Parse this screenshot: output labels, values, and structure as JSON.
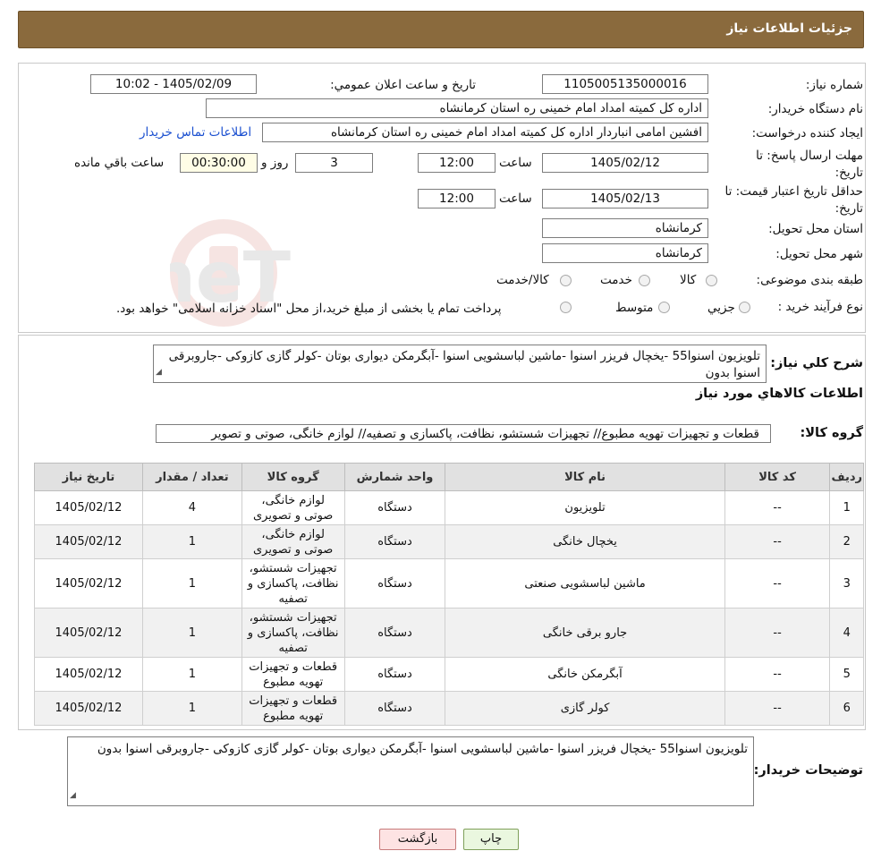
{
  "page_title": "جزئیات اطلاعات نیاز",
  "form": {
    "need_number_label": "شماره نیاز:",
    "need_number": "1105005135000016",
    "announce_label": "تاریخ و ساعت اعلان عمومي:",
    "announce_value": "1405/02/09 - 10:02",
    "buyer_org_label": "نام دستگاه خریدار:",
    "buyer_org": "اداره کل کمیته امداد امام خمینی  ره  استان کرمانشاه",
    "creator_label": "ایجاد کننده درخواست:",
    "creator": "افشین امامی انباردار اداره کل کمیته امداد امام خمینی  ره  استان کرمانشاه",
    "contact_link": "اطلاعات تماس خریدار",
    "reply_deadline_label": "مهلت ارسال پاسخ: تا تاریخ:",
    "reply_date": "1405/02/12",
    "time_label": "ساعت",
    "reply_time": "12:00",
    "days": "3",
    "days_label": "روز و",
    "remaining": "00:30:00",
    "remaining_label": "ساعت باقي مانده",
    "price_validity_label": "حداقل تاریخ اعتبار قیمت: تا تاریخ:",
    "price_date": "1405/02/13",
    "price_time": "12:00",
    "province_label": "استان محل تحویل:",
    "province": "کرمانشاه",
    "city_label": "شهر محل تحویل:",
    "city": "کرمانشاه",
    "category_label": "طبقه بندی موضوعی:",
    "category_options": [
      "کالا",
      "خدمت",
      "کالا/خدمت"
    ],
    "process_label": "نوع فرآیند خرید :",
    "process_options": [
      "جزیي",
      "متوسط"
    ],
    "process_note": "پرداخت تمام یا بخشی از مبلغ خرید،از محل \"اسناد خزانه اسلامی\" خواهد بود."
  },
  "watermark": "AriaTender.neT",
  "summary": {
    "label": "شرح کلي نیاز:",
    "text": "تلویزیون اسنوا55 -یخچال فریزر اسنوا -ماشین لباسشویی اسنوا -آبگرمکن دیواری بوتان -کولر گازی کازوکی -جاروبرقی اسنوا  بدون"
  },
  "goods_info_title": "اطلاعات کالاهاي مورد نیاز",
  "goods_group": {
    "label": "گروه کالا:",
    "value": "قطعات و تجهیزات تهویه مطبوع// تجهیزات شستشو، نظافت، پاکسازی و تصفیه// لوازم خانگی، صوتی و تصویر"
  },
  "table": {
    "headers": [
      "ردیف",
      "کد کالا",
      "نام کالا",
      "واحد شمارش",
      "گروه کالا",
      "تعداد / مقدار",
      "تاریخ نیاز"
    ],
    "rows": [
      {
        "idx": "1",
        "code": "--",
        "name": "تلویزیون",
        "unit": "دستگاه",
        "group": "لوازم خانگی، صوتی و تصویری",
        "qty": "4",
        "date": "1405/02/12"
      },
      {
        "idx": "2",
        "code": "--",
        "name": "یخچال خانگی",
        "unit": "دستگاه",
        "group": "لوازم خانگی، صوتی و تصویری",
        "qty": "1",
        "date": "1405/02/12"
      },
      {
        "idx": "3",
        "code": "--",
        "name": "ماشین لباسشویی صنعتی",
        "unit": "دستگاه",
        "group": "تجهیزات شستشو، نظافت، پاکسازی و تصفیه",
        "qty": "1",
        "date": "1405/02/12"
      },
      {
        "idx": "4",
        "code": "--",
        "name": "جارو برقی خانگی",
        "unit": "دستگاه",
        "group": "تجهیزات شستشو، نظافت، پاکسازی و تصفیه",
        "qty": "1",
        "date": "1405/02/12"
      },
      {
        "idx": "5",
        "code": "--",
        "name": "آبگرمکن خانگی",
        "unit": "دستگاه",
        "group": "قطعات و تجهیزات تهویه مطبوع",
        "qty": "1",
        "date": "1405/02/12"
      },
      {
        "idx": "6",
        "code": "--",
        "name": "کولر گازی",
        "unit": "دستگاه",
        "group": "قطعات و تجهیزات تهویه مطبوع",
        "qty": "1",
        "date": "1405/02/12"
      }
    ]
  },
  "buyer_notes": {
    "label": "توضیحات خریدار:",
    "text": "تلویزیون اسنوا55 -یخچال فریزر اسنوا -ماشین لباسشویی اسنوا -آبگرمکن دیواری بوتان -کولر گازی کازوکی -جاروبرقی اسنوا بدون"
  },
  "buttons": {
    "print": "چاپ",
    "back": "بازگشت"
  }
}
